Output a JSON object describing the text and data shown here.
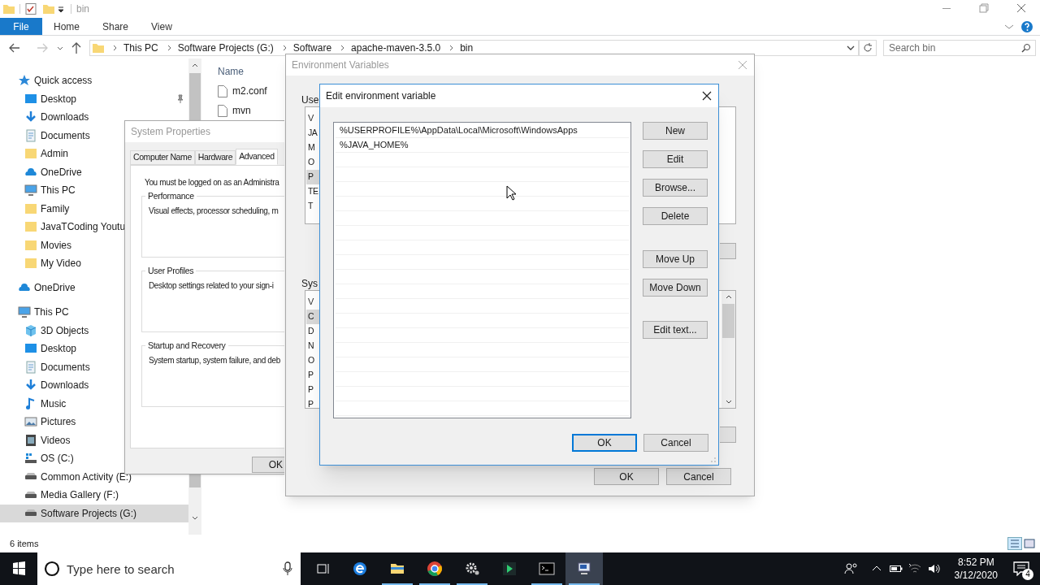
{
  "explorer": {
    "title": "bin",
    "ribbon_tabs": [
      {
        "label": "File",
        "kind": "file"
      },
      {
        "label": "Home",
        "kind": "tab"
      },
      {
        "label": "Share",
        "kind": "tab"
      },
      {
        "label": "View",
        "kind": "tab"
      }
    ],
    "breadcrumb": [
      "This PC",
      "Software Projects (G:)",
      "Software",
      "apache-maven-3.5.0",
      "bin"
    ],
    "search": {
      "placeholder": "Search bin"
    },
    "nav_tree": [
      {
        "label": "Quick access",
        "kind": "star",
        "selected": false,
        "children": [
          {
            "label": "Desktop",
            "kind": "desktop",
            "selected": false,
            "pinned": true
          },
          {
            "label": "Downloads",
            "kind": "download",
            "selected": false
          },
          {
            "label": "Documents",
            "kind": "document",
            "selected": false
          },
          {
            "label": "Admin",
            "kind": "folder",
            "selected": false
          },
          {
            "label": "OneDrive",
            "kind": "cloud",
            "selected": false
          },
          {
            "label": "This PC",
            "kind": "pc",
            "selected": false
          },
          {
            "label": "Family",
            "kind": "folder",
            "selected": false
          },
          {
            "label": "JavaTCoding Youtu",
            "kind": "folder",
            "selected": false
          },
          {
            "label": "Movies",
            "kind": "folder",
            "selected": false
          },
          {
            "label": "My Video",
            "kind": "folder",
            "selected": false
          }
        ]
      },
      {
        "label": "OneDrive",
        "kind": "cloud",
        "selected": false
      },
      {
        "label": "This PC",
        "kind": "pc",
        "selected": false,
        "children": [
          {
            "label": "3D Objects",
            "kind": "cube",
            "selected": false
          },
          {
            "label": "Desktop",
            "kind": "desktop",
            "selected": false
          },
          {
            "label": "Documents",
            "kind": "document",
            "selected": false
          },
          {
            "label": "Downloads",
            "kind": "download",
            "selected": false
          },
          {
            "label": "Music",
            "kind": "music",
            "selected": false
          },
          {
            "label": "Pictures",
            "kind": "pictures",
            "selected": false
          },
          {
            "label": "Videos",
            "kind": "video",
            "selected": false
          },
          {
            "label": "OS (C:)",
            "kind": "windrive",
            "selected": false
          },
          {
            "label": "Common Activity (E:)",
            "kind": "drive",
            "selected": false
          },
          {
            "label": "Media Gallery (F:)",
            "kind": "drive",
            "selected": false
          },
          {
            "label": "Software Projects (G:)",
            "kind": "drive",
            "selected": true
          }
        ]
      }
    ],
    "file_list": {
      "columns": [
        "Name"
      ],
      "files": [
        "m2.conf",
        "mvn"
      ]
    },
    "status_bar": "6 items"
  },
  "system_properties": {
    "title": "System Properties",
    "tabs": [
      {
        "label": "Computer Name",
        "selected": false
      },
      {
        "label": "Hardware",
        "selected": false
      },
      {
        "label": "Advanced",
        "selected": true
      }
    ],
    "notice": "You must be logged on as an Administra",
    "groups": [
      {
        "title": "Performance",
        "text": "Visual effects, processor scheduling, m"
      },
      {
        "title": "User Profiles",
        "text": "Desktop settings related to your sign-i"
      },
      {
        "title": "Startup and Recovery",
        "text": "System startup, system failure, and deb"
      }
    ],
    "buttons": [
      "OK"
    ]
  },
  "environment_variables": {
    "title": "Environment Variables",
    "user_label": "Use",
    "user_list": {
      "header": "V",
      "rows": [
        {
          "text": "JA",
          "selected": false
        },
        {
          "text": "M",
          "selected": false
        },
        {
          "text": "O",
          "selected": false
        },
        {
          "text": "P",
          "selected": true
        },
        {
          "text": "TE",
          "selected": false
        },
        {
          "text": "T",
          "selected": false
        }
      ]
    },
    "system_label": "Sys",
    "system_list": {
      "header": "V",
      "rows": [
        {
          "text": "C",
          "selected": true
        },
        {
          "text": "D",
          "selected": false
        },
        {
          "text": "N",
          "selected": false
        },
        {
          "text": "O",
          "selected": false
        },
        {
          "text": "P",
          "selected": false
        },
        {
          "text": "P",
          "selected": false
        },
        {
          "text": "P",
          "selected": false
        }
      ]
    },
    "buttons": [
      {
        "label": "OK"
      },
      {
        "label": "Cancel"
      }
    ]
  },
  "edit_environment_variable": {
    "title": "Edit environment variable",
    "entries": [
      "%USERPROFILE%\\AppData\\Local\\Microsoft\\WindowsApps",
      "%JAVA_HOME%"
    ],
    "side_buttons": [
      [
        "New",
        "Edit",
        "Browse...",
        "Delete"
      ],
      [
        "Move Up",
        "Move Down"
      ],
      [
        "Edit text..."
      ]
    ],
    "footer_buttons": [
      {
        "label": "OK",
        "default": true
      },
      {
        "label": "Cancel",
        "default": false
      }
    ]
  },
  "taskbar": {
    "search": {
      "placeholder": "Type here to search"
    },
    "apps": [
      {
        "kind": "taskview",
        "running": false
      },
      {
        "kind": "edge",
        "running": false
      },
      {
        "kind": "explorer",
        "running": true
      },
      {
        "kind": "chrome",
        "running": true
      },
      {
        "kind": "gear",
        "running": true
      },
      {
        "kind": "arrow",
        "running": false
      },
      {
        "kind": "terminal",
        "running": true
      },
      {
        "kind": "sysprops",
        "running": true
      }
    ],
    "time": "8:52 PM",
    "date": "3/12/2020",
    "notifications": "4"
  }
}
